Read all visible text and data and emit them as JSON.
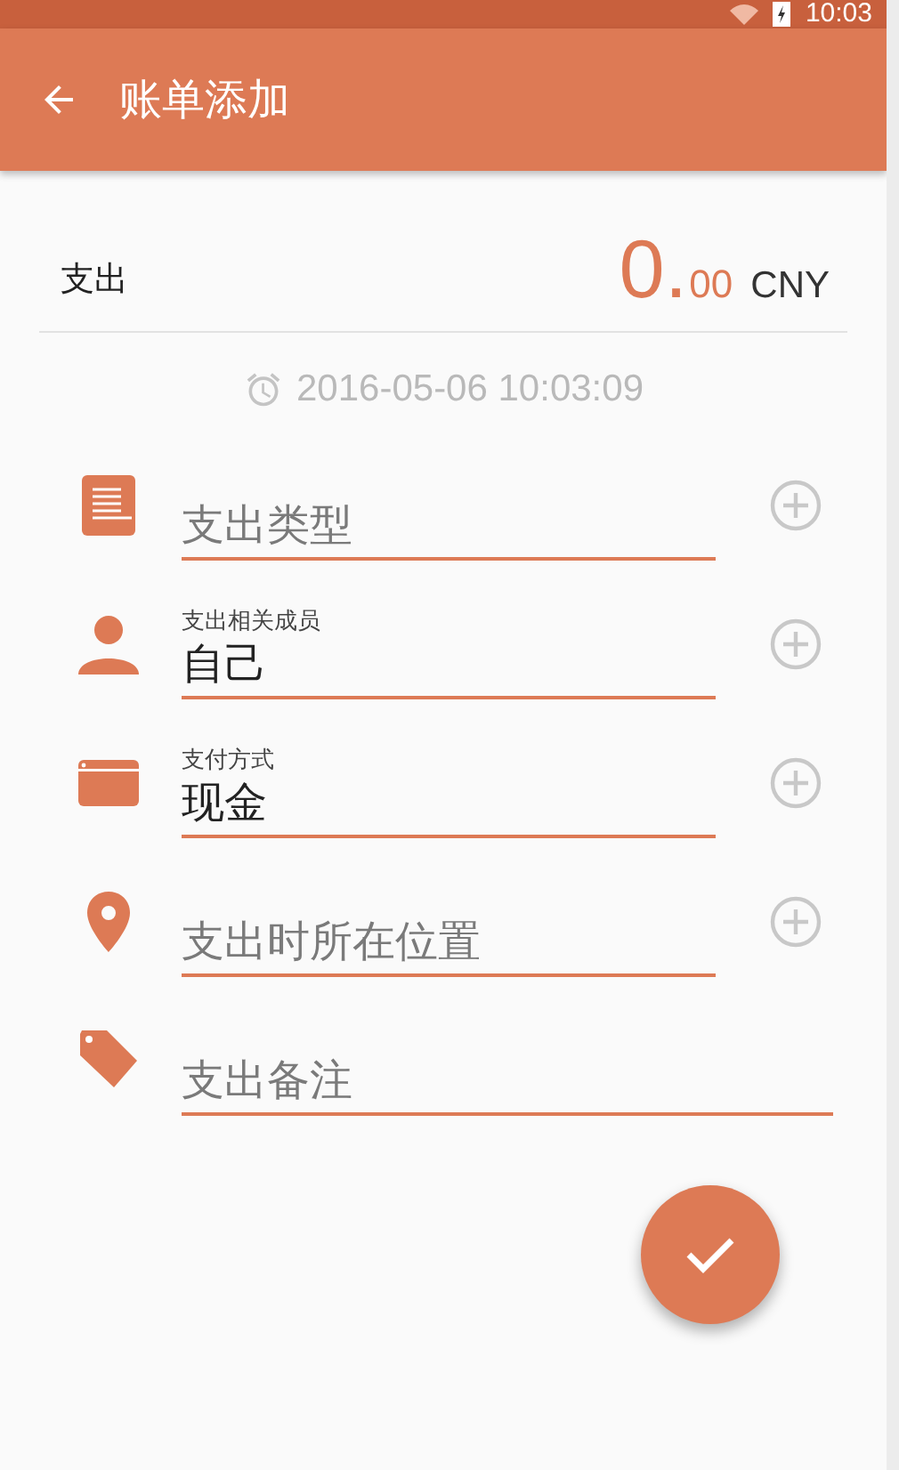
{
  "status_bar": {
    "time": "10:03"
  },
  "toolbar": {
    "title": "账单添加"
  },
  "amount": {
    "type_label": "支出",
    "integer": "0.",
    "decimals": "00",
    "currency": "CNY"
  },
  "timestamp": "2016-05-06 10:03:09",
  "fields": [
    {
      "kind": "plain",
      "placeholder": "支出类型",
      "add": true
    },
    {
      "kind": "labeled",
      "label": "支出相关成员",
      "value": "自己",
      "add": true
    },
    {
      "kind": "labeled",
      "label": "支付方式",
      "value": "现金",
      "add": true
    },
    {
      "kind": "plain",
      "placeholder": "支出时所在位置",
      "add": true
    },
    {
      "kind": "plain",
      "placeholder": "支出备注",
      "add": false
    }
  ]
}
